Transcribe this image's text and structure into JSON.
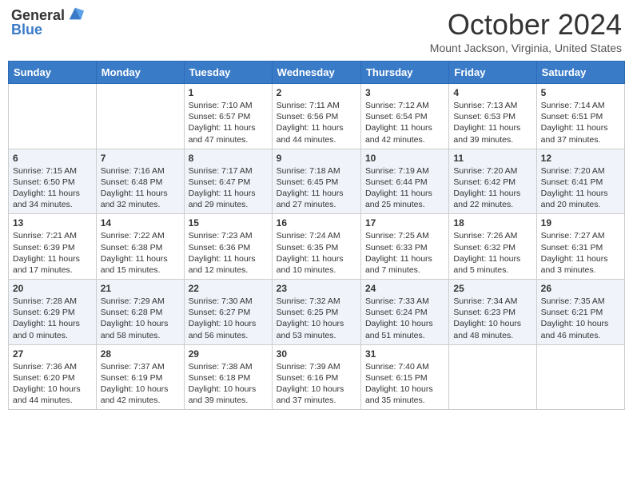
{
  "header": {
    "logo_general": "General",
    "logo_blue": "Blue",
    "month_title": "October 2024",
    "location": "Mount Jackson, Virginia, United States"
  },
  "days_of_week": [
    "Sunday",
    "Monday",
    "Tuesday",
    "Wednesday",
    "Thursday",
    "Friday",
    "Saturday"
  ],
  "weeks": [
    [
      {
        "day": "",
        "sunrise": "",
        "sunset": "",
        "daylight": ""
      },
      {
        "day": "",
        "sunrise": "",
        "sunset": "",
        "daylight": ""
      },
      {
        "day": "1",
        "sunrise": "Sunrise: 7:10 AM",
        "sunset": "Sunset: 6:57 PM",
        "daylight": "Daylight: 11 hours and 47 minutes."
      },
      {
        "day": "2",
        "sunrise": "Sunrise: 7:11 AM",
        "sunset": "Sunset: 6:56 PM",
        "daylight": "Daylight: 11 hours and 44 minutes."
      },
      {
        "day": "3",
        "sunrise": "Sunrise: 7:12 AM",
        "sunset": "Sunset: 6:54 PM",
        "daylight": "Daylight: 11 hours and 42 minutes."
      },
      {
        "day": "4",
        "sunrise": "Sunrise: 7:13 AM",
        "sunset": "Sunset: 6:53 PM",
        "daylight": "Daylight: 11 hours and 39 minutes."
      },
      {
        "day": "5",
        "sunrise": "Sunrise: 7:14 AM",
        "sunset": "Sunset: 6:51 PM",
        "daylight": "Daylight: 11 hours and 37 minutes."
      }
    ],
    [
      {
        "day": "6",
        "sunrise": "Sunrise: 7:15 AM",
        "sunset": "Sunset: 6:50 PM",
        "daylight": "Daylight: 11 hours and 34 minutes."
      },
      {
        "day": "7",
        "sunrise": "Sunrise: 7:16 AM",
        "sunset": "Sunset: 6:48 PM",
        "daylight": "Daylight: 11 hours and 32 minutes."
      },
      {
        "day": "8",
        "sunrise": "Sunrise: 7:17 AM",
        "sunset": "Sunset: 6:47 PM",
        "daylight": "Daylight: 11 hours and 29 minutes."
      },
      {
        "day": "9",
        "sunrise": "Sunrise: 7:18 AM",
        "sunset": "Sunset: 6:45 PM",
        "daylight": "Daylight: 11 hours and 27 minutes."
      },
      {
        "day": "10",
        "sunrise": "Sunrise: 7:19 AM",
        "sunset": "Sunset: 6:44 PM",
        "daylight": "Daylight: 11 hours and 25 minutes."
      },
      {
        "day": "11",
        "sunrise": "Sunrise: 7:20 AM",
        "sunset": "Sunset: 6:42 PM",
        "daylight": "Daylight: 11 hours and 22 minutes."
      },
      {
        "day": "12",
        "sunrise": "Sunrise: 7:20 AM",
        "sunset": "Sunset: 6:41 PM",
        "daylight": "Daylight: 11 hours and 20 minutes."
      }
    ],
    [
      {
        "day": "13",
        "sunrise": "Sunrise: 7:21 AM",
        "sunset": "Sunset: 6:39 PM",
        "daylight": "Daylight: 11 hours and 17 minutes."
      },
      {
        "day": "14",
        "sunrise": "Sunrise: 7:22 AM",
        "sunset": "Sunset: 6:38 PM",
        "daylight": "Daylight: 11 hours and 15 minutes."
      },
      {
        "day": "15",
        "sunrise": "Sunrise: 7:23 AM",
        "sunset": "Sunset: 6:36 PM",
        "daylight": "Daylight: 11 hours and 12 minutes."
      },
      {
        "day": "16",
        "sunrise": "Sunrise: 7:24 AM",
        "sunset": "Sunset: 6:35 PM",
        "daylight": "Daylight: 11 hours and 10 minutes."
      },
      {
        "day": "17",
        "sunrise": "Sunrise: 7:25 AM",
        "sunset": "Sunset: 6:33 PM",
        "daylight": "Daylight: 11 hours and 7 minutes."
      },
      {
        "day": "18",
        "sunrise": "Sunrise: 7:26 AM",
        "sunset": "Sunset: 6:32 PM",
        "daylight": "Daylight: 11 hours and 5 minutes."
      },
      {
        "day": "19",
        "sunrise": "Sunrise: 7:27 AM",
        "sunset": "Sunset: 6:31 PM",
        "daylight": "Daylight: 11 hours and 3 minutes."
      }
    ],
    [
      {
        "day": "20",
        "sunrise": "Sunrise: 7:28 AM",
        "sunset": "Sunset: 6:29 PM",
        "daylight": "Daylight: 11 hours and 0 minutes."
      },
      {
        "day": "21",
        "sunrise": "Sunrise: 7:29 AM",
        "sunset": "Sunset: 6:28 PM",
        "daylight": "Daylight: 10 hours and 58 minutes."
      },
      {
        "day": "22",
        "sunrise": "Sunrise: 7:30 AM",
        "sunset": "Sunset: 6:27 PM",
        "daylight": "Daylight: 10 hours and 56 minutes."
      },
      {
        "day": "23",
        "sunrise": "Sunrise: 7:32 AM",
        "sunset": "Sunset: 6:25 PM",
        "daylight": "Daylight: 10 hours and 53 minutes."
      },
      {
        "day": "24",
        "sunrise": "Sunrise: 7:33 AM",
        "sunset": "Sunset: 6:24 PM",
        "daylight": "Daylight: 10 hours and 51 minutes."
      },
      {
        "day": "25",
        "sunrise": "Sunrise: 7:34 AM",
        "sunset": "Sunset: 6:23 PM",
        "daylight": "Daylight: 10 hours and 48 minutes."
      },
      {
        "day": "26",
        "sunrise": "Sunrise: 7:35 AM",
        "sunset": "Sunset: 6:21 PM",
        "daylight": "Daylight: 10 hours and 46 minutes."
      }
    ],
    [
      {
        "day": "27",
        "sunrise": "Sunrise: 7:36 AM",
        "sunset": "Sunset: 6:20 PM",
        "daylight": "Daylight: 10 hours and 44 minutes."
      },
      {
        "day": "28",
        "sunrise": "Sunrise: 7:37 AM",
        "sunset": "Sunset: 6:19 PM",
        "daylight": "Daylight: 10 hours and 42 minutes."
      },
      {
        "day": "29",
        "sunrise": "Sunrise: 7:38 AM",
        "sunset": "Sunset: 6:18 PM",
        "daylight": "Daylight: 10 hours and 39 minutes."
      },
      {
        "day": "30",
        "sunrise": "Sunrise: 7:39 AM",
        "sunset": "Sunset: 6:16 PM",
        "daylight": "Daylight: 10 hours and 37 minutes."
      },
      {
        "day": "31",
        "sunrise": "Sunrise: 7:40 AM",
        "sunset": "Sunset: 6:15 PM",
        "daylight": "Daylight: 10 hours and 35 minutes."
      },
      {
        "day": "",
        "sunrise": "",
        "sunset": "",
        "daylight": ""
      },
      {
        "day": "",
        "sunrise": "",
        "sunset": "",
        "daylight": ""
      }
    ]
  ]
}
